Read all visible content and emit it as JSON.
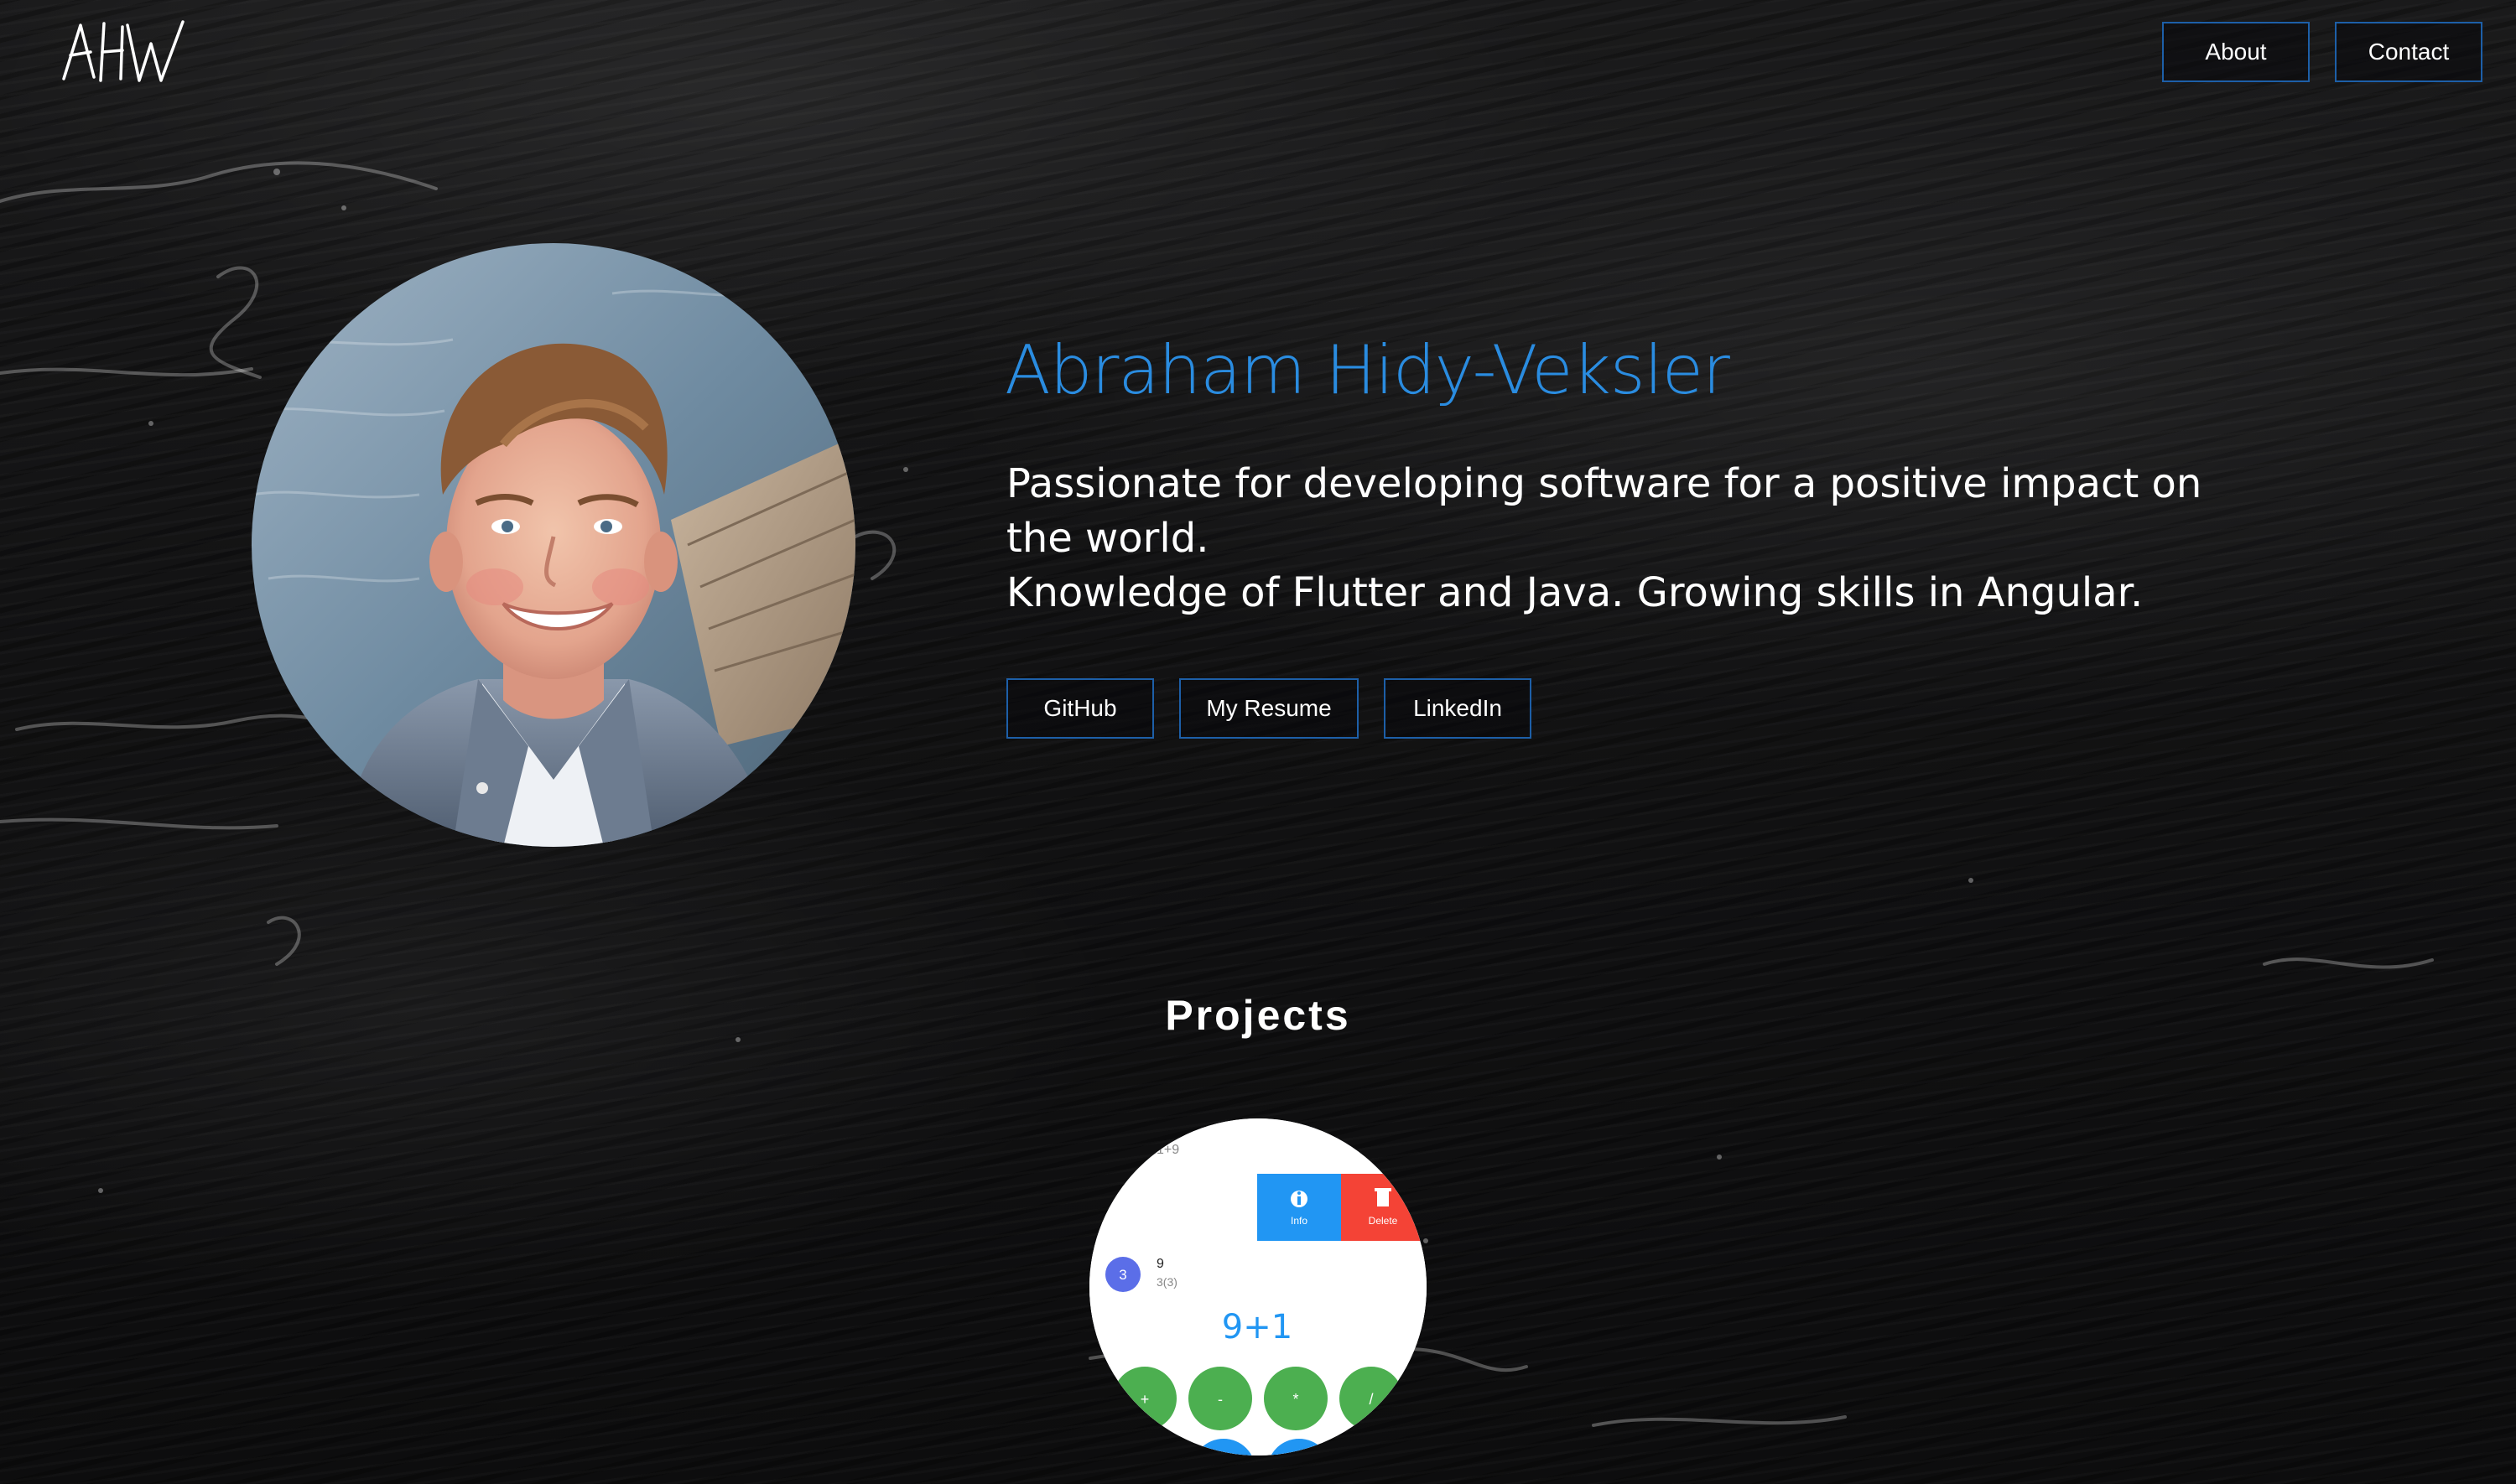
{
  "brand": {
    "logo_text": "AHW",
    "logo_alt": "AHW"
  },
  "nav": {
    "items": [
      {
        "label": "About"
      },
      {
        "label": "Contact"
      }
    ]
  },
  "hero": {
    "name": "Abraham Hidy-Veksler",
    "line1": "Passionate for developing software for a positive impact on the world.",
    "line2": "Knowledge of Flutter and Java. Growing skills in Angular.",
    "buttons": {
      "github": "GitHub",
      "resume": "My Resume",
      "linkedin": "LinkedIn"
    }
  },
  "projects": {
    "title": "Projects",
    "thumb": {
      "history_top": "1+9",
      "action_info": "Info",
      "action_delete": "Delete",
      "avatar_value": "3",
      "entry_value": "9",
      "entry_sub": "3(3)",
      "display": "9+1",
      "ops": [
        "+",
        "-",
        "*",
        "/"
      ]
    }
  },
  "colors": {
    "accent": "#2a8ce0",
    "button_border": "#1d5fa8",
    "background": "#0f0f10",
    "thumb_info": "#2196f3",
    "thumb_delete": "#f44336",
    "thumb_key": "#4caf50",
    "thumb_avatar": "#5b6ee8"
  }
}
